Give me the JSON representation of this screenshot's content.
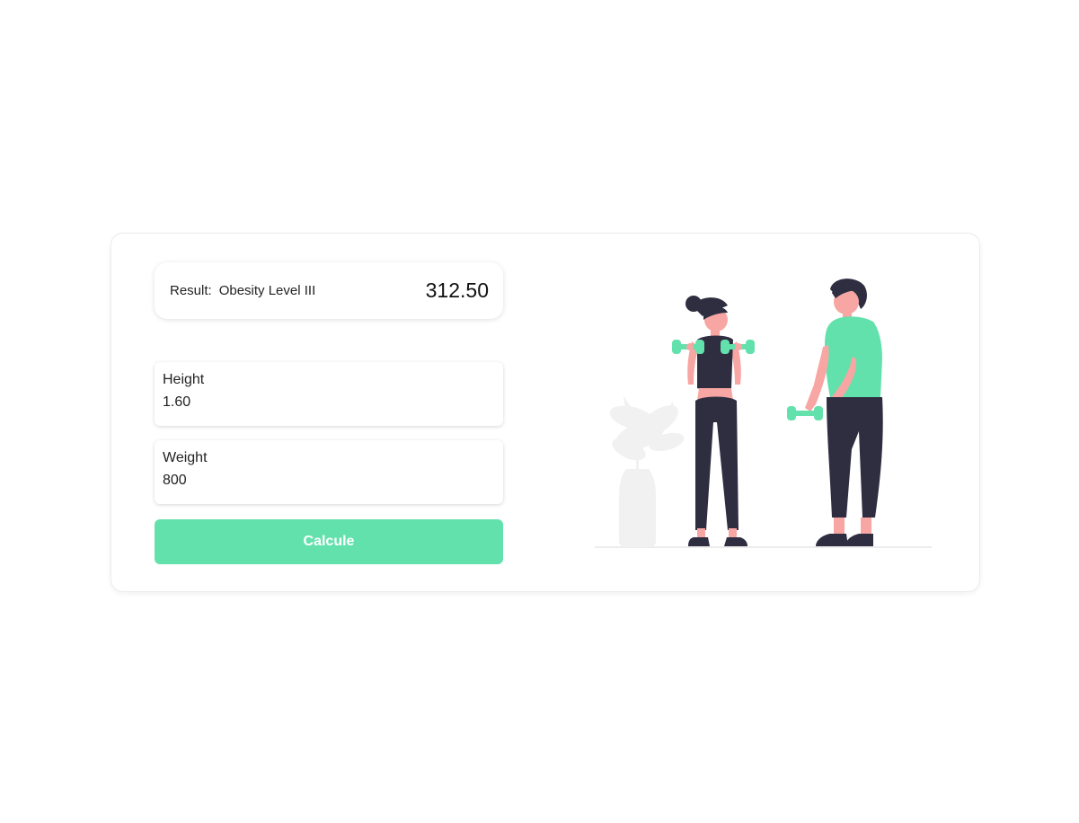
{
  "result": {
    "label": "Result:",
    "category": "Obesity Level III",
    "value": "312.50"
  },
  "height": {
    "label": "Height",
    "value": "1.60"
  },
  "weight": {
    "label": "Weight",
    "value": "800"
  },
  "calculate_button": {
    "label": "Calcule"
  },
  "illustration": {
    "name": "fitness-illustration",
    "colors": {
      "accent": "#63e1ac",
      "skin": "#f7a6a3",
      "dark": "#2f2e41",
      "plant": "#f1f1f1"
    }
  },
  "colors": {
    "accent": "#63e1ac"
  }
}
